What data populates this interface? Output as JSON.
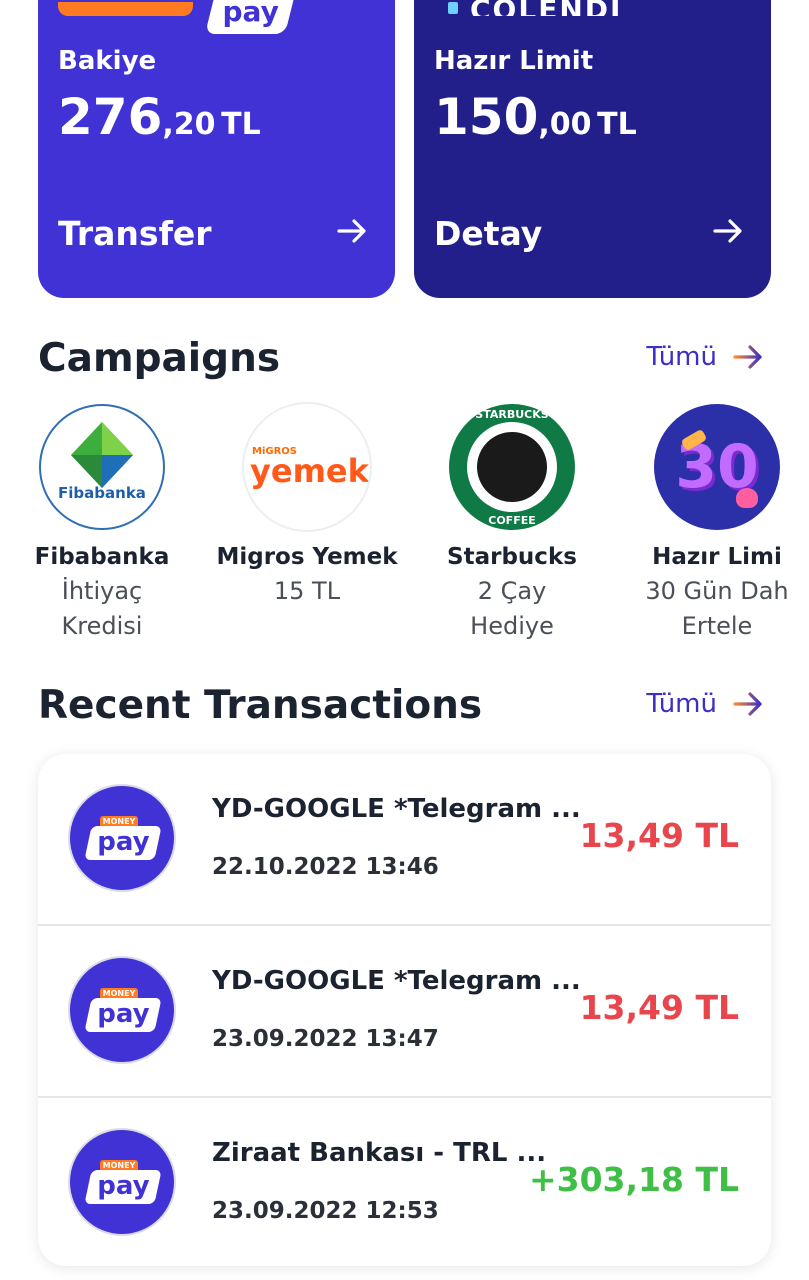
{
  "colors": {
    "balance_card": "#4132d6",
    "limit_card": "#221f8a",
    "accent": "#3d2fc6",
    "accent_arrow": "#ff8a2b",
    "negative": "#e8454d",
    "positive": "#3fbf45"
  },
  "cards": {
    "balance": {
      "brand_money": "MONEY",
      "brand_pay": "pay",
      "label": "Bakiye",
      "amount_int": "276",
      "amount_dec": ",20",
      "currency": "TL",
      "action": "Transfer",
      "action_icon": "arrow-right-icon"
    },
    "limit": {
      "brand": "COLENDI",
      "label": "Hazır Limit",
      "amount_int": "150",
      "amount_dec": ",00",
      "currency": "TL",
      "action": "Detay",
      "action_icon": "arrow-right-icon"
    }
  },
  "campaigns": {
    "title": "Campaigns",
    "see_all": "Tümü",
    "items": [
      {
        "name": "Fibabanka",
        "desc1": "İhtiyaç",
        "desc2": "Kredisi",
        "logo_text": "Fibabanka"
      },
      {
        "name": "Migros Yemek",
        "desc1": "15 TL",
        "desc2": "",
        "logo_text_top": "MiGROS",
        "logo_text": "yemek"
      },
      {
        "name": "Starbucks",
        "desc1": "2 Çay",
        "desc2": "Hediye",
        "logo_text_top": "STARBUCKS",
        "logo_text": "COFFEE"
      },
      {
        "name": "Hazır Limi",
        "desc1": "30 Gün Dah",
        "desc2": "Ertele",
        "logo_text": "30"
      }
    ]
  },
  "transactions": {
    "title": "Recent Transactions",
    "see_all": "Tümü",
    "items": [
      {
        "merchant": "YD-GOOGLE *Telegram ...",
        "date": "22.10.2022 13:46",
        "amount": "13,49 TL",
        "type": "debit"
      },
      {
        "merchant": "YD-GOOGLE *Telegram ...",
        "date": "23.09.2022 13:47",
        "amount": "13,49 TL",
        "type": "debit"
      },
      {
        "merchant": "Ziraat Bankası - TRL ...",
        "date": "23.09.2022 12:53",
        "amount": "+303,18 TL",
        "type": "credit"
      }
    ],
    "logo_money": "MONEY",
    "logo_pay": "pay"
  }
}
